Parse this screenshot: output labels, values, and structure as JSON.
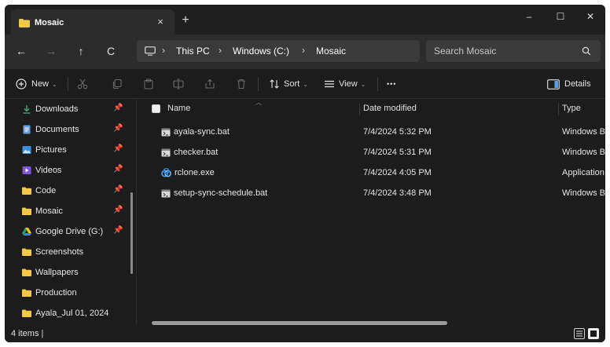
{
  "tab": {
    "title": "Mosaic",
    "close": "×",
    "new_tab": "+"
  },
  "window_controls": {
    "minimize": "–",
    "maximize": "☐",
    "close": "✕"
  },
  "nav": {
    "back": "←",
    "forward": "→",
    "up": "↑",
    "refresh": "C"
  },
  "breadcrumb": [
    "This PC",
    "Windows (C:)",
    "Mosaic"
  ],
  "breadcrumb_sep": "›",
  "search": {
    "placeholder": "Search Mosaic"
  },
  "toolbar": {
    "new_label": "New",
    "sort_label": "Sort",
    "view_label": "View",
    "more_label": "•••",
    "details_label": "Details",
    "caret": "⌄"
  },
  "sidebar": {
    "items": [
      {
        "label": "Downloads",
        "icon": "download-icon",
        "pinned": true
      },
      {
        "label": "Documents",
        "icon": "documents-icon",
        "pinned": true
      },
      {
        "label": "Pictures",
        "icon": "pictures-icon",
        "pinned": true
      },
      {
        "label": "Videos",
        "icon": "videos-icon",
        "pinned": true
      },
      {
        "label": "Code",
        "icon": "folder-icon",
        "pinned": true
      },
      {
        "label": "Mosaic",
        "icon": "folder-icon",
        "pinned": true
      },
      {
        "label": "Google Drive (G:)",
        "icon": "google-drive-icon",
        "pinned": true
      },
      {
        "label": "Screenshots",
        "icon": "folder-icon",
        "pinned": false
      },
      {
        "label": "Wallpapers",
        "icon": "folder-icon",
        "pinned": false
      },
      {
        "label": "Production",
        "icon": "folder-icon",
        "pinned": false
      },
      {
        "label": "Ayala_Jul 01, 2024",
        "icon": "folder-icon",
        "pinned": false
      }
    ],
    "pin_glyph": "📌"
  },
  "columns": {
    "name": "Name",
    "date": "Date modified",
    "type": "Type"
  },
  "files": [
    {
      "name": "ayala-sync.bat",
      "date": "7/4/2024 5:32 PM",
      "type": "Windows Ba",
      "icon": "batch-file-icon"
    },
    {
      "name": "checker.bat",
      "date": "7/4/2024 5:31 PM",
      "type": "Windows Ba",
      "icon": "batch-file-icon"
    },
    {
      "name": "rclone.exe",
      "date": "7/4/2024 4:05 PM",
      "type": "Application",
      "icon": "rclone-app-icon"
    },
    {
      "name": "setup-sync-schedule.bat",
      "date": "7/4/2024 3:48 PM",
      "type": "Windows Ba",
      "icon": "batch-file-icon"
    }
  ],
  "status": {
    "count": "4 items |"
  },
  "colors": {
    "folder": "#f3c846",
    "accent": "#4ca3ef",
    "bg": "#1c1c1c",
    "tab": "#2c2c2c"
  }
}
